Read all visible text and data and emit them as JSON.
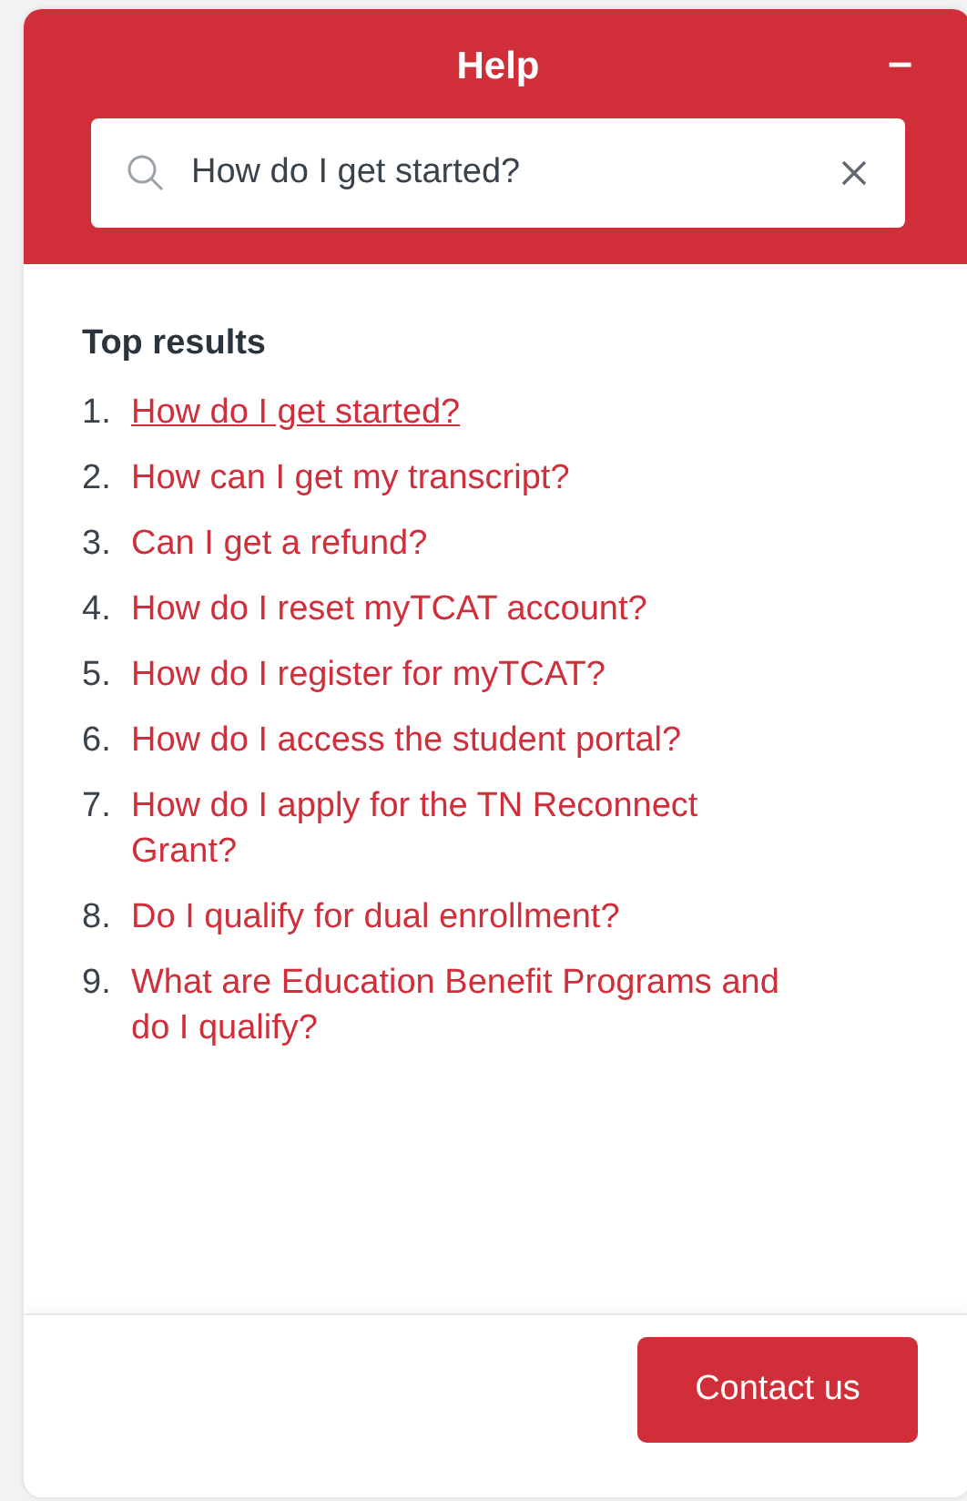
{
  "header": {
    "title": "Help",
    "minimize": "–"
  },
  "search": {
    "value": "How do I get started?"
  },
  "results": {
    "heading": "Top results",
    "items": [
      {
        "number": "1.",
        "text": "How do I get started?",
        "selected": true
      },
      {
        "number": "2.",
        "text": "How can I get my transcript?",
        "selected": false
      },
      {
        "number": "3.",
        "text": "Can I get a refund?",
        "selected": false
      },
      {
        "number": "4.",
        "text": "How do I reset myTCAT account?",
        "selected": false
      },
      {
        "number": "5.",
        "text": "How do I register for myTCAT?",
        "selected": false
      },
      {
        "number": "6.",
        "text": "How do I access the student portal?",
        "selected": false
      },
      {
        "number": "7.",
        "text": "How do I apply for the TN Reconnect Grant?",
        "selected": false
      },
      {
        "number": "8.",
        "text": "Do I qualify for dual enrollment?",
        "selected": false
      },
      {
        "number": "9.",
        "text": "What are Education Benefit Programs and do I qualify?",
        "selected": false
      }
    ]
  },
  "footer": {
    "button": "Contact us"
  }
}
